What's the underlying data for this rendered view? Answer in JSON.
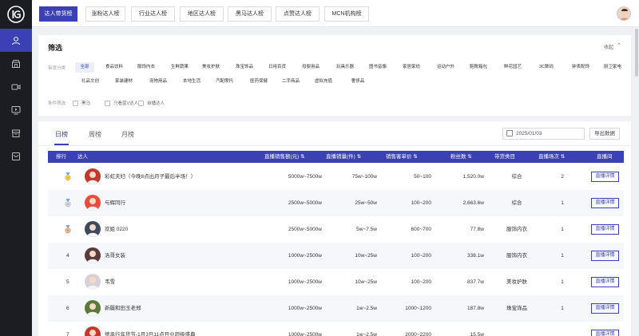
{
  "top_tabs": [
    {
      "label": "达人带货榜",
      "active": true
    },
    {
      "label": "涨粉达人榜",
      "active": false
    },
    {
      "label": "行业达人榜",
      "active": false
    },
    {
      "label": "地区达人榜",
      "active": false
    },
    {
      "label": "黑马达人榜",
      "active": false
    },
    {
      "label": "点赞达人榜",
      "active": false
    },
    {
      "label": "MCN机构榜",
      "active": false
    }
  ],
  "sidebar": {
    "icons": [
      "user-icon",
      "shop-icon",
      "video-icon",
      "live-icon",
      "box-icon",
      "store-icon"
    ],
    "accent": "#3b40b4"
  },
  "filter": {
    "title": "筛选",
    "collapse_label": "收起",
    "category_label": "带货分类",
    "categories": [
      "全部",
      "食品饮料",
      "服饰内衣",
      "生鲜蔬果",
      "美妆护肤",
      "珠宝饰品",
      "日用百货",
      "母婴用品",
      "玩具乐器",
      "图书音像",
      "家居家纺",
      "运动户外",
      "鞋靴箱包",
      "鲜花园艺",
      "3C数码",
      "钟表配饰",
      "厨卫家电",
      "礼品文创",
      "家装建材",
      "宠物用品",
      "本地生活",
      "汽配摩托",
      "医药保健",
      "二手商品",
      "虚拟充值",
      "奢侈品"
    ],
    "condition_label": "条件筛选",
    "checkboxes": [
      "黑马",
      "只看蓝V达人",
      "自播达人"
    ]
  },
  "ranking": {
    "tabs": [
      "日榜",
      "周榜",
      "月榜"
    ],
    "date": "2025/01/03",
    "export_label": "导出数据",
    "columns": [
      "排行",
      "达人",
      "直播销售额(元)",
      "直播销量(件)",
      "销售客单价",
      "粉丝数",
      "带货类目",
      "直播场次",
      "直播间"
    ],
    "detail_label": "直播详情",
    "rows": [
      {
        "rank": "",
        "medal": "gold",
        "name": "彩虹夫妇（今晚8点出月子最后半场！）",
        "sales": "5000w~7500w",
        "volume": "75w~100w",
        "price": "50~100",
        "fans": "1,520.0w",
        "category": "综合",
        "sessions": "2",
        "avatar_color": "#c0392b"
      },
      {
        "rank": "",
        "medal": "silver",
        "name": "与辉同行",
        "sales": "2500w~5000w",
        "volume": "25w~50w",
        "price": "100~200",
        "fans": "2,663.6w",
        "category": "综合",
        "sessions": "1",
        "avatar_color": "#e74c3c"
      },
      {
        "rank": "",
        "medal": "bronze",
        "name": "欢姐 0220",
        "sales": "2500w~5000w",
        "volume": "5w~7.5w",
        "price": "600~700",
        "fans": "77.8w",
        "category": "服饰内衣",
        "sessions": "1",
        "avatar_color": "#3d4a5c"
      },
      {
        "rank": "4",
        "medal": "",
        "name": "洛哥女装",
        "sales": "1000w~2500w",
        "volume": "10w~25w",
        "price": "100~200",
        "fans": "338.1w",
        "category": "服饰内衣",
        "sessions": "1",
        "avatar_color": "#5a3a3a"
      },
      {
        "rank": "5",
        "medal": "",
        "name": "韦雪",
        "sales": "1000w~2500w",
        "volume": "10w~25w",
        "price": "100~200",
        "fans": "837.7w",
        "category": "美妆护肤",
        "sessions": "1",
        "avatar_color": "#d8d0d8"
      },
      {
        "rank": "6",
        "medal": "",
        "name": "新疆和田玉老郑",
        "sales": "1000w~2500w",
        "volume": "1w~2.5w",
        "price": "1000~1200",
        "fans": "187.8w",
        "category": "珠宝饰品",
        "sessions": "1",
        "avatar_color": "#5a7a3a"
      },
      {
        "rank": "7",
        "medal": "",
        "name": "德承行年货节-1月3日11点开业超级盛典",
        "sales": "1000w~2500w",
        "volume": "1w~2.5w",
        "price": "2000~2200",
        "fans": "15.5w",
        "category": "",
        "sessions": "",
        "avatar_color": "#c0392b"
      }
    ]
  }
}
